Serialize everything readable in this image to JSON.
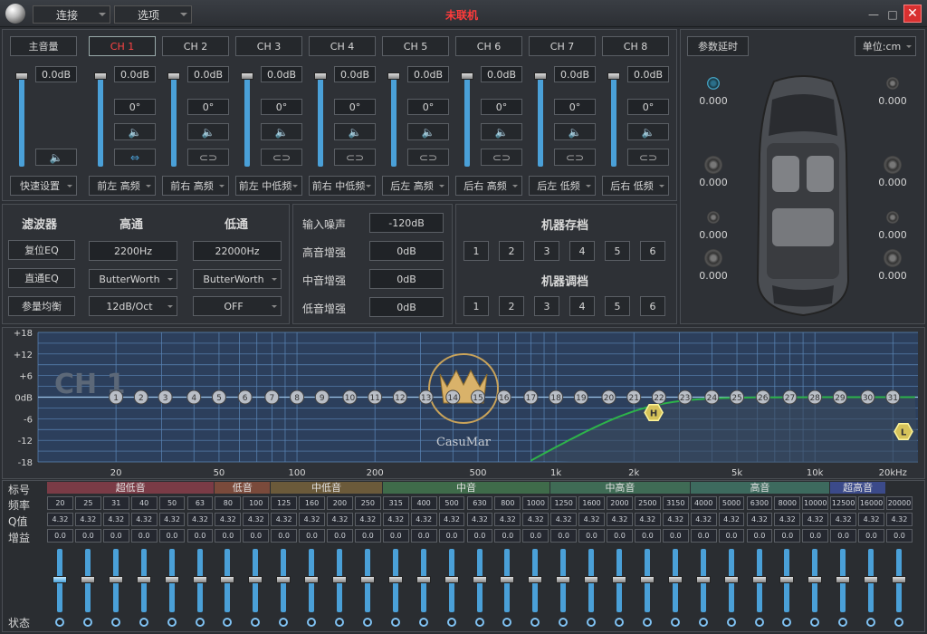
{
  "titlebar": {
    "menu_connect": "连接",
    "menu_options": "选项",
    "status": "未联机",
    "minimize": "—",
    "maximize": "□",
    "close": "✕"
  },
  "channels": {
    "master": "主音量",
    "tabs": [
      "CH 1",
      "CH 2",
      "CH 3",
      "CH 4",
      "CH 5",
      "CH 6",
      "CH 7",
      "CH 8"
    ],
    "level": "0.0dB",
    "phase": "0°",
    "quick": "快速设置",
    "names": [
      "前左 高频",
      "前右 高频",
      "前左 中低频",
      "前右 中低频",
      "后左 高频",
      "后右 高频",
      "后左 低频",
      "后右 低频"
    ]
  },
  "delay": {
    "preset_label": "参数延时",
    "unit_label": "单位:cm",
    "values": [
      "0.000",
      "0.000",
      "0.000",
      "0.000",
      "0.000",
      "0.000",
      "0.000",
      "0.000"
    ]
  },
  "filter": {
    "title": "滤波器",
    "high": "高通",
    "low": "低通",
    "reset": "复位EQ",
    "bypass": "直通EQ",
    "peq": "参量均衡",
    "hp_freq": "2200Hz",
    "lp_freq": "22000Hz",
    "hp_type": "ButterWorth",
    "lp_type": "ButterWorth",
    "hp_slope": "12dB/Oct",
    "lp_slope": "OFF"
  },
  "gains": {
    "input_noise": "输入噪声",
    "input_noise_val": "-120dB",
    "treble": "高音增强",
    "treble_val": "0dB",
    "mid": "中音增强",
    "mid_val": "0dB",
    "bass": "低音增强",
    "bass_val": "0dB"
  },
  "memory": {
    "save_title": "机器存档",
    "load_title": "机器调档",
    "slots": [
      "1",
      "2",
      "3",
      "4",
      "5",
      "6"
    ]
  },
  "eq_graph": {
    "channel": "CH 1",
    "y_ticks": [
      "+18",
      "+12",
      "+6",
      "0dB",
      "-6",
      "-12",
      "-18"
    ],
    "x_ticks": [
      "20",
      "50",
      "100",
      "200",
      "500",
      "1k",
      "2k",
      "5k",
      "10k",
      "20kHz"
    ],
    "points": [
      "1",
      "2",
      "3",
      "4",
      "5",
      "6",
      "7",
      "8",
      "9",
      "10",
      "11",
      "12",
      "13",
      "14",
      "15",
      "16",
      "17",
      "18",
      "19",
      "20",
      "21",
      "22",
      "23",
      "24",
      "25",
      "26",
      "27",
      "28",
      "29",
      "30",
      "31"
    ],
    "hp_marker": "H",
    "lp_marker": "L",
    "brand": "CasuMar"
  },
  "eq_bands": {
    "row_labels": {
      "band": "标号",
      "freq": "频率",
      "q": "Q值",
      "gain": "增益",
      "state": "状态"
    },
    "groups": [
      {
        "name": "超低音",
        "color": "#7a3b46"
      },
      {
        "name": "低音",
        "color": "#7a4a3b"
      },
      {
        "name": "中低音",
        "color": "#6b5a3a"
      },
      {
        "name": "中音",
        "color": "#3f6b4a"
      },
      {
        "name": "中高音",
        "color": "#3f6b55"
      },
      {
        "name": "高音",
        "color": "#3d6a5e"
      },
      {
        "name": "超高音",
        "color": "#3b4a8a"
      }
    ],
    "freqs": [
      "20",
      "25",
      "31",
      "40",
      "50",
      "63",
      "80",
      "100",
      "125",
      "160",
      "200",
      "250",
      "315",
      "400",
      "500",
      "630",
      "800",
      "1000",
      "1250",
      "1600",
      "2000",
      "2500",
      "3150",
      "4000",
      "5000",
      "6300",
      "8000",
      "10000",
      "12500",
      "16000",
      "20000"
    ],
    "q": "4.32",
    "gain": "0.0"
  }
}
